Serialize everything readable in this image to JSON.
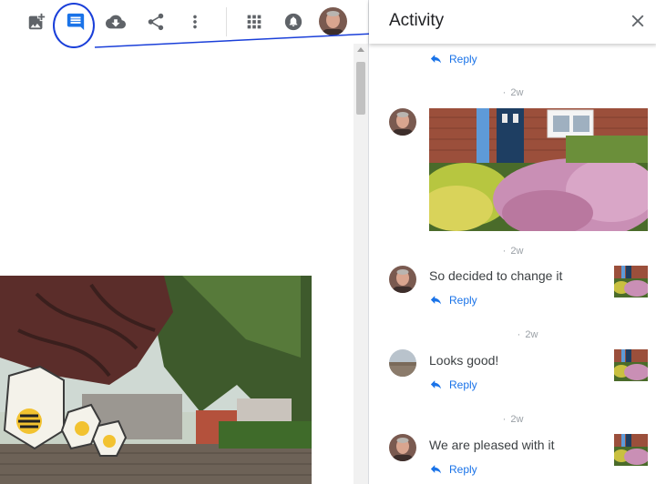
{
  "toolbar": {
    "buttons": [
      {
        "name": "add-photo-icon"
      },
      {
        "name": "comment-icon",
        "active": true
      },
      {
        "name": "download-icon"
      },
      {
        "name": "share-icon"
      },
      {
        "name": "more-vert-icon"
      },
      {
        "name": "apps-grid-icon"
      },
      {
        "name": "notifications-icon"
      }
    ],
    "accent_color": "#1a73e8"
  },
  "panel": {
    "title": "Activity",
    "close_icon": "close-icon"
  },
  "activity": {
    "top_reply": "Reply",
    "items": [
      {
        "time": "2w",
        "type": "photo",
        "reply": ""
      },
      {
        "time": "2w",
        "text": "So decided to change it",
        "reply": "Reply"
      },
      {
        "time": "2w",
        "text": "Looks good!",
        "reply": "Reply"
      },
      {
        "time": "2w",
        "text": "We are pleased with it",
        "reply": "Reply"
      }
    ]
  },
  "colors": {
    "link": "#1a73e8",
    "annotation": "#1a3fd9",
    "timestamp": "#9aa0a6"
  }
}
